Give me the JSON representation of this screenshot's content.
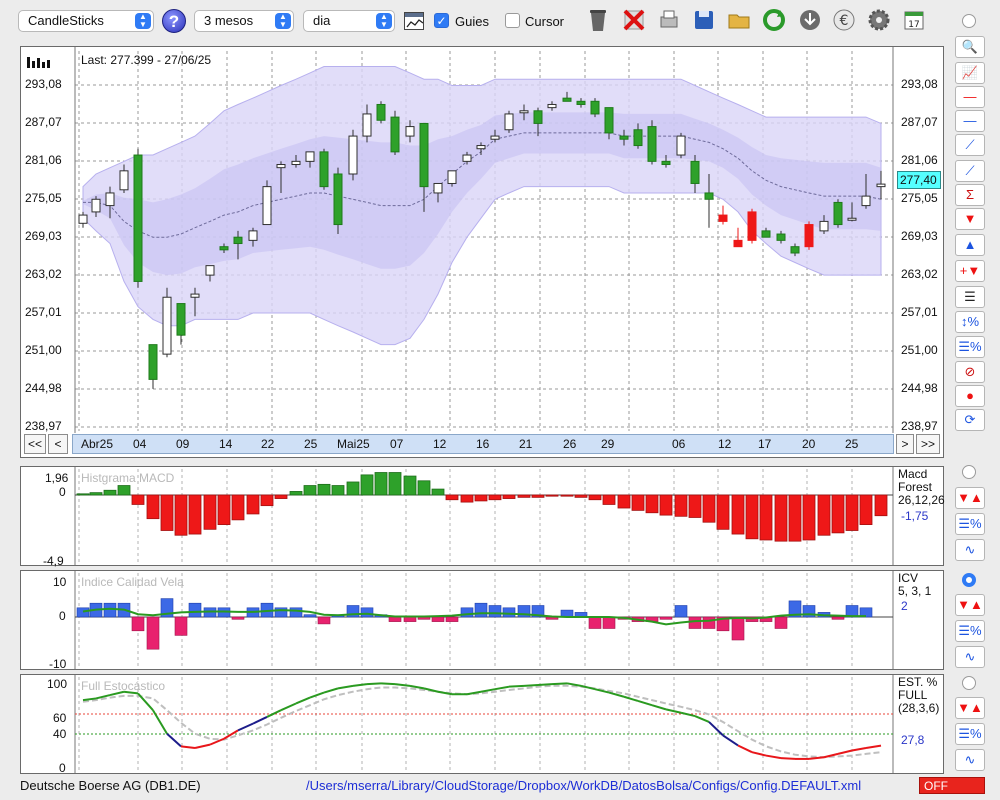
{
  "toolbar": {
    "chart_type": "CandleSticks",
    "help_label": "?",
    "period": "3 mesos",
    "interval": "dia",
    "guides_label": "Guies",
    "cursor_label": "Cursor"
  },
  "main_panel": {
    "last_info": "Last: 277.399 - 27/06/25",
    "price_badge": "277,40",
    "y_ticks": [
      "293,08",
      "287,07",
      "281,06",
      "275,05",
      "269,03",
      "263,02",
      "257,01",
      "251,00",
      "244,98",
      "238,97"
    ],
    "date_labels": [
      "Abr25",
      "04",
      "09",
      "14",
      "22",
      "25",
      "Mai25",
      "07",
      "12",
      "16",
      "21",
      "26",
      "29",
      "06",
      "12",
      "17",
      "20",
      "25"
    ]
  },
  "nav": {
    "first": "<<",
    "prev": "<",
    "next": ">",
    "last": ">>"
  },
  "macd_panel": {
    "title": "Histgrama MACD",
    "y_top": "1,96",
    "y_zero": "0",
    "y_bottom": "-4,9",
    "name_line1": "Macd",
    "name_line2": "Forest",
    "params": "26,12,26",
    "value": "-1,75"
  },
  "icv_panel": {
    "title": "Indice Calidad Vela",
    "y_top": "10",
    "y_zero": "0",
    "y_bottom": "-10",
    "name": "ICV",
    "params": "5, 3, 1",
    "value": "2"
  },
  "stoch_panel": {
    "title": "Full Estocástico",
    "y_ticks": [
      "100",
      "60",
      "40",
      "0"
    ],
    "name_line1": "EST. %",
    "name_line2": "FULL",
    "params": "(28,3,6)",
    "value": "27,8"
  },
  "status": {
    "instrument": "Deutsche Boerse AG (DB1.DE)",
    "config_path": "/Users/mserra/Library/CloudStorage/Dropbox/WorkDB/DatosBolsa/Configs/Config.DEFAULT.xml",
    "off_label": "OFF"
  },
  "colors": {
    "up": "#2ea12a",
    "down": "#ee1818",
    "band": "#c9c4f5",
    "bar_blue": "#3c69e6",
    "bar_pink": "#e8226e"
  },
  "sidebar_icons": [
    "magnifier-icon",
    "price-chart-icon",
    "horizontal-line-red-icon",
    "horizontal-line-blue-icon",
    "trend-grid-icon",
    "trend-line-icon",
    "sigma-line-icon",
    "arrow-down-red-icon",
    "arrow-up-blue-icon",
    "add-arrows-icon",
    "lines-icon",
    "range-percent-icon",
    "lines-percent-icon",
    "stop-icon",
    "record-icon",
    "refresh-icon"
  ]
}
